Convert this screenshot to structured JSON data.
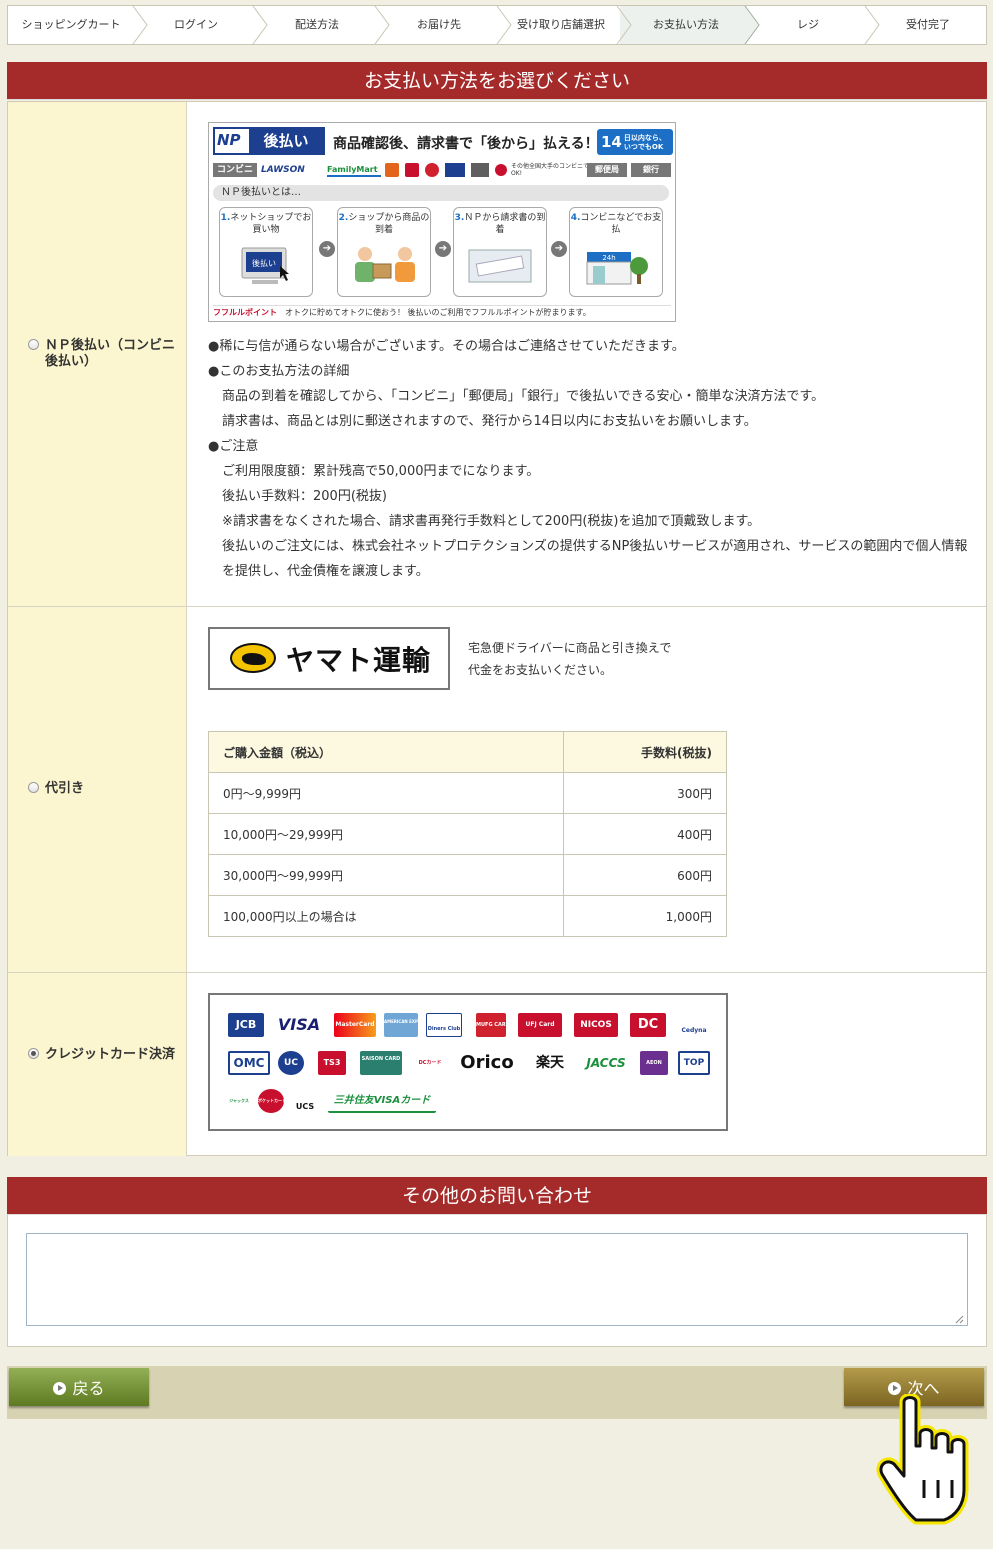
{
  "steps": [
    {
      "label": "ショッピングカート",
      "active": false
    },
    {
      "label": "ログイン",
      "active": false
    },
    {
      "label": "配送方法",
      "active": false
    },
    {
      "label": "お届け先",
      "active": false
    },
    {
      "label": "受け取り店舗選択",
      "active": false
    },
    {
      "label": "お支払い方法",
      "active": true
    },
    {
      "label": "レジ",
      "active": false
    },
    {
      "label": "受付完了",
      "active": false
    }
  ],
  "payment": {
    "title": "お支払い方法をお選びください",
    "np": {
      "label": "ＮＰ後払い（コンビニ後払い）",
      "selected": false,
      "banner": {
        "logo_np": "NP",
        "logo_ato": "後払い",
        "slogan": "商品確認後、請求書で「後から」払える！",
        "badge_num": "14",
        "badge_text": "日以内なら、いつでもOK",
        "stores": [
          "コンビニ",
          "LAWSON",
          "FamilyMart",
          "その他全国大手のコンビニでもOK!",
          "郵便局",
          "銀行"
        ],
        "what": "ＮＰ後払いとは…",
        "steps": [
          {
            "num": "1.",
            "text": "ネットショップでお買い物"
          },
          {
            "num": "2.",
            "text": "ショップから商品の到着"
          },
          {
            "num": "3.",
            "text": "ＮＰから請求書の到着"
          },
          {
            "num": "4.",
            "text": "コンビニなどでお支払"
          }
        ],
        "screen_label": "後払い",
        "shop_label": "24h",
        "foot_brand": "フフルルポイント",
        "foot_text": "オトクに貯めてオトクに使おう！ 後払いのご利用でフフルルポイントが貯まります。"
      },
      "lines": [
        {
          "text": "●稀に与信が通らない場合がございます。その場合はご連絡させていただきます。",
          "indent": false
        },
        {
          "text": "●このお支払方法の詳細",
          "indent": false
        },
        {
          "text": "商品の到着を確認してから、「コンビニ」「郵便局」「銀行」で後払いできる安心・簡単な決済方法です。",
          "indent": true
        },
        {
          "text": "請求書は、商品とは別に郵送されますので、発行から14日以内にお支払いをお願いします。",
          "indent": true
        },
        {
          "text": "●ご注意",
          "indent": false
        },
        {
          "text": "ご利用限度額：累計残高で50,000円までになります。",
          "indent": true
        },
        {
          "text": "後払い手数料：200円(税抜)",
          "indent": true
        },
        {
          "text": "※請求書をなくされた場合、請求書再発行手数料として200円(税抜)を追加で頂戴致します。",
          "indent": true
        },
        {
          "text": "後払いのご注文には、株式会社ネットプロテクションズの提供するNP後払いサービスが適用され、サービスの範囲内で個人情報を提供し、代金債権を譲渡します。",
          "indent": true
        }
      ]
    },
    "cod": {
      "label": "代引き",
      "selected": false,
      "logo_text": "ヤマト運輸",
      "description_1": "宅急便ドライバーに商品と引き換えで",
      "description_2": "代金をお支払いください。",
      "table": {
        "headers": [
          "ご購入金額（税込）",
          "手数料(税抜)"
        ],
        "rows": [
          [
            "0円～9,999円",
            "300円"
          ],
          [
            "10,000円～29,999円",
            "400円"
          ],
          [
            "30,000円～99,999円",
            "600円"
          ],
          [
            "100,000円以上の場合は",
            "1,000円"
          ]
        ]
      }
    },
    "card": {
      "label": "クレジットカード決済",
      "selected": true,
      "brands": [
        "JCB",
        "VISA",
        "MasterCard",
        "AMERICAN EXPRESS",
        "Diners Club",
        "MUFG CARD",
        "UFJ Card",
        "NICOS",
        "DC",
        "Cedyna",
        "OMC",
        "UC",
        "TS3",
        "SAISON CARD",
        "DCカード",
        "Orico",
        "楽天",
        "JACCS",
        "AEON",
        "TOP",
        "ジャックス",
        "ポケットカード",
        "UCS",
        "三井住友VISAカード"
      ]
    }
  },
  "inquiry": {
    "title": "その他のお問い合わせ",
    "value": "",
    "placeholder": ""
  },
  "nav": {
    "back_label": "戻る",
    "next_label": "次へ"
  },
  "colors": {
    "header_red": "#a52a2a",
    "label_bg": "#fbf6cf",
    "back_green": "#6f8c2e",
    "next_gold": "#8f7a32"
  }
}
